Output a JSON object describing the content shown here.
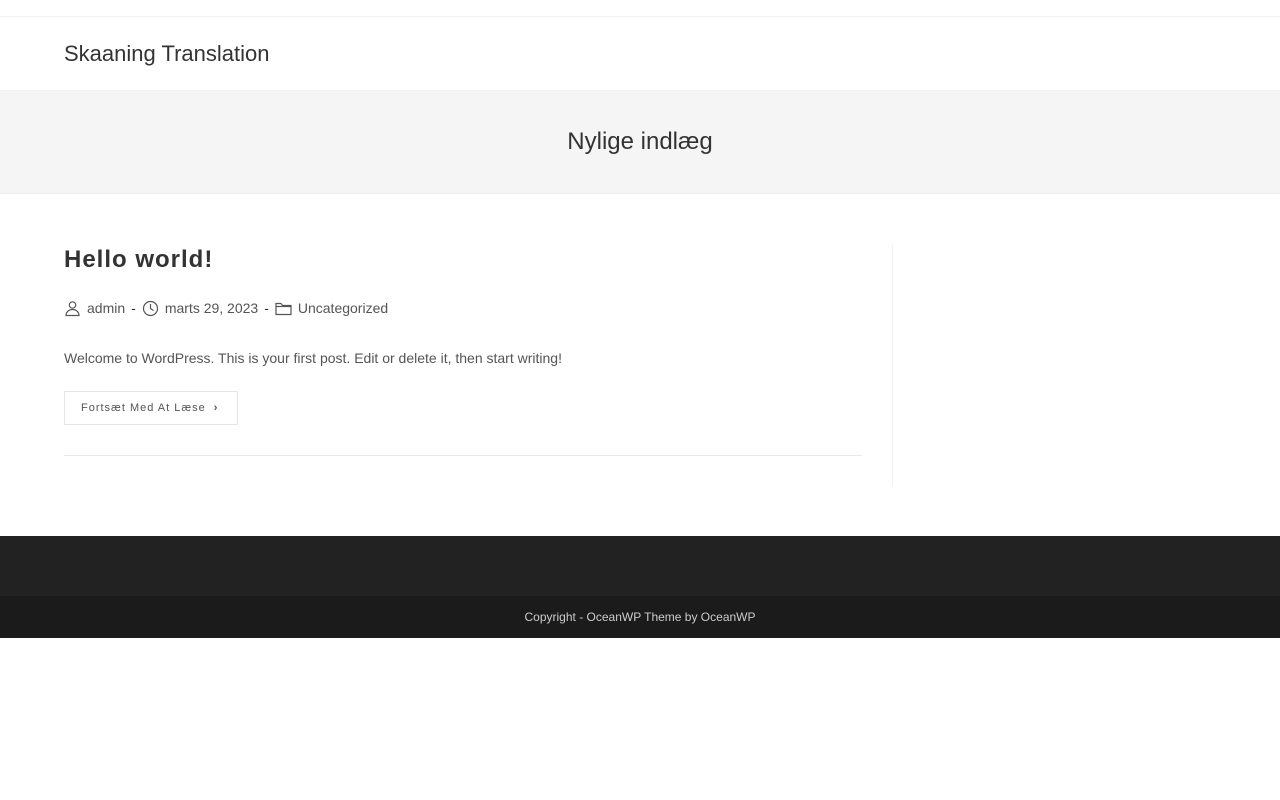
{
  "site": {
    "title": "Skaaning Translation"
  },
  "page_header": {
    "title": "Nylige indlæg"
  },
  "post": {
    "title": "Hello world!",
    "meta": {
      "author": "admin",
      "date": "marts 29, 2023",
      "category": "Uncategorized",
      "separator": "-"
    },
    "excerpt": "Welcome to WordPress. This is your first post. Edit or delete it, then start writing!",
    "read_more_label": "Fortsæt Med At Læse",
    "icons": [
      "user-icon",
      "clock-icon",
      "folder-icon",
      "chevron-right-icon"
    ]
  },
  "footer": {
    "copyright_prefix": "Copyright - ",
    "copyright_link": "OceanWP Theme by OceanWP"
  },
  "colors": {
    "text": "#333333",
    "page_header_bg": "#f5f5f5",
    "footer_widgets_bg": "#222222",
    "footer_bottom_bg": "#1b1b1b"
  }
}
